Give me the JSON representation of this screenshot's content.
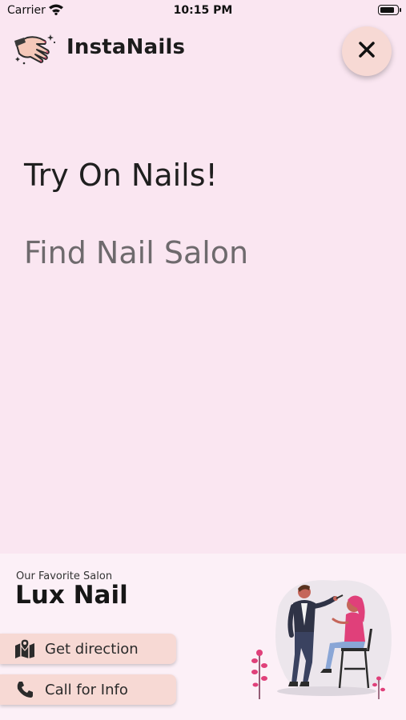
{
  "status_bar": {
    "carrier": "Carrier",
    "time": "10:15 PM",
    "battery_level": 0.9
  },
  "header": {
    "app_name": "InstaNails"
  },
  "menu": {
    "items": [
      "Try On Nails!",
      "Find Nail Salon"
    ]
  },
  "salon": {
    "caption": "Our Favorite Salon",
    "name": "Lux Nail",
    "actions": {
      "direction": "Get direction",
      "call": "Call for Info"
    }
  },
  "colors": {
    "background": "#fae6f1",
    "panel": "#fcf0f7",
    "button": "#f7d9d4",
    "accent": "#e0407a"
  },
  "icons": [
    "hand-nails-logo-icon",
    "close-icon",
    "map-icon",
    "phone-icon"
  ]
}
